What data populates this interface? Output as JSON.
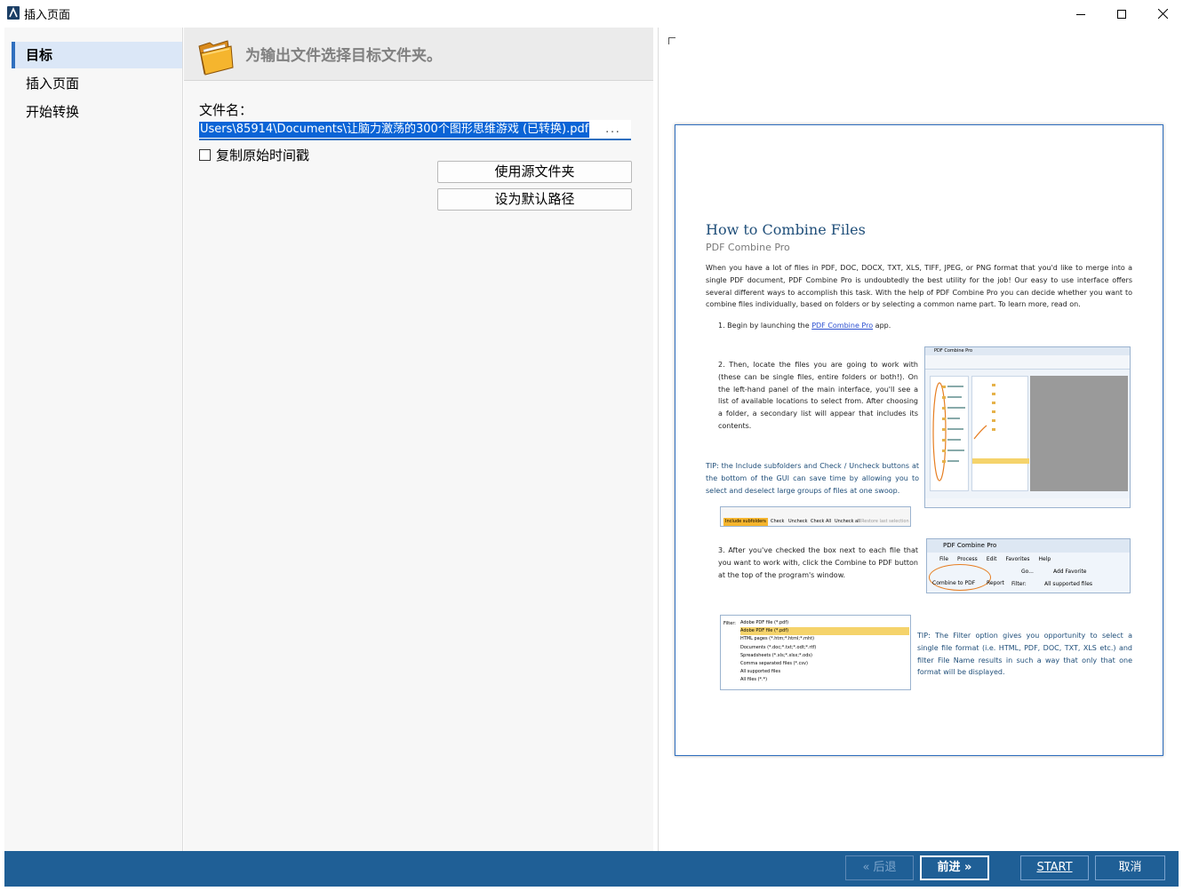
{
  "window": {
    "title": "插入页面",
    "icon": "app-logo-icon",
    "controls": [
      "minimize-icon",
      "maximize-icon",
      "close-icon"
    ]
  },
  "nav": {
    "items": [
      {
        "label": "目标",
        "active": true
      },
      {
        "label": "插入页面",
        "active": false
      },
      {
        "label": "开始转换",
        "active": false
      }
    ]
  },
  "target": {
    "header": "为输出文件选择目标文件夹。",
    "header_icon": "folder-icon",
    "filename_label": "文件名：",
    "filename_value": "Users\\85914\\Documents\\让脑力激荡的300个图形思维游戏 (已转换).pdf",
    "browse_label": "...",
    "keep_timestamp_label": "复制原始时间戳",
    "keep_timestamp_checked": false,
    "use_source_folder": "使用源文件夹",
    "set_default_path": "设为默认路径"
  },
  "preview": {
    "title": "How to Combine Files",
    "subtitle": "PDF Combine Pro",
    "intro": "When you have a lot of files in PDF, DOC, DOCX, TXT, XLS, TIFF, JPEG, or PNG format that you'd like to merge into a single PDF document, PDF Combine Pro is undoubtedly the best utility for the job! Our easy to use interface offers several different ways to accomplish this task. With the help of PDF Combine Pro you can decide whether you want to combine files individually, based on folders or by selecting a common name part. To learn more, read on.",
    "step1_prefix": "1.   Begin by launching the",
    "step1_link": "PDF Combine Pro",
    "step1_suffix": "app.",
    "step2": "2.   Then, locate the files you are going to work with (these can be single files, entire folders or both!). On the left-hand panel of the main interface, you'll see a list of available locations to select from. After choosing a folder, a secondary list will appear that includes its contents.",
    "tip1": "TIP: the Include subfolders and Check / Uncheck buttons at the bottom of the GUI can save time by allowing you to select and deselect large groups of files at one swoop.",
    "step3": "3.   After you've checked the box next to each file that you want to work with, click the Combine to PDF button at the top of the program's window.",
    "tip2": "TIP: The Filter option gives you opportunity to select a single file format (i.e. HTML, PDF, DOC, TXT, XLS etc.) and filter File Name results in such a way that only that one format will be displayed.",
    "shot1_title": "PDF Combine Pro",
    "shot2_title": "PDF Combine Pro",
    "shot2_menu": [
      "File",
      "Process",
      "Edit",
      "Favorites",
      "Help"
    ],
    "shot2_button": "Combine to PDF",
    "shot2_report": "Report",
    "shot2_go": "Go...",
    "shot2_favorite": "Add Favorite",
    "shot2_filter_label": "Filter:",
    "shot2_filter_value": "All supported files",
    "shot3_filter_label": "Filter:",
    "shot3_items": [
      "Adobe PDF file (*.pdf)",
      "Adobe PDF file (*.pdf)",
      "HTML pages (*.htm;*.html;*.mht)",
      "Documents (*.doc;*.txt;*.odt;*.rtf)",
      "Spreadsheets (*.xls;*.xlsx;*.ods)",
      "Comma separated files (*.csv)",
      "All supported files",
      "All files (*.*)"
    ],
    "shot4_items": [
      "Include subfolders",
      "Check",
      "Uncheck",
      "Check All",
      "Uncheck all",
      "Restore last selection"
    ]
  },
  "footer": {
    "back": "« 后退",
    "next": "前进 »",
    "start": "START",
    "cancel": "取消"
  },
  "colors": {
    "accent": "#2f6fbf",
    "footer_bg": "#1f5f96",
    "selection": "#0a64d6",
    "nav_active_bg": "#dbe7f7"
  }
}
